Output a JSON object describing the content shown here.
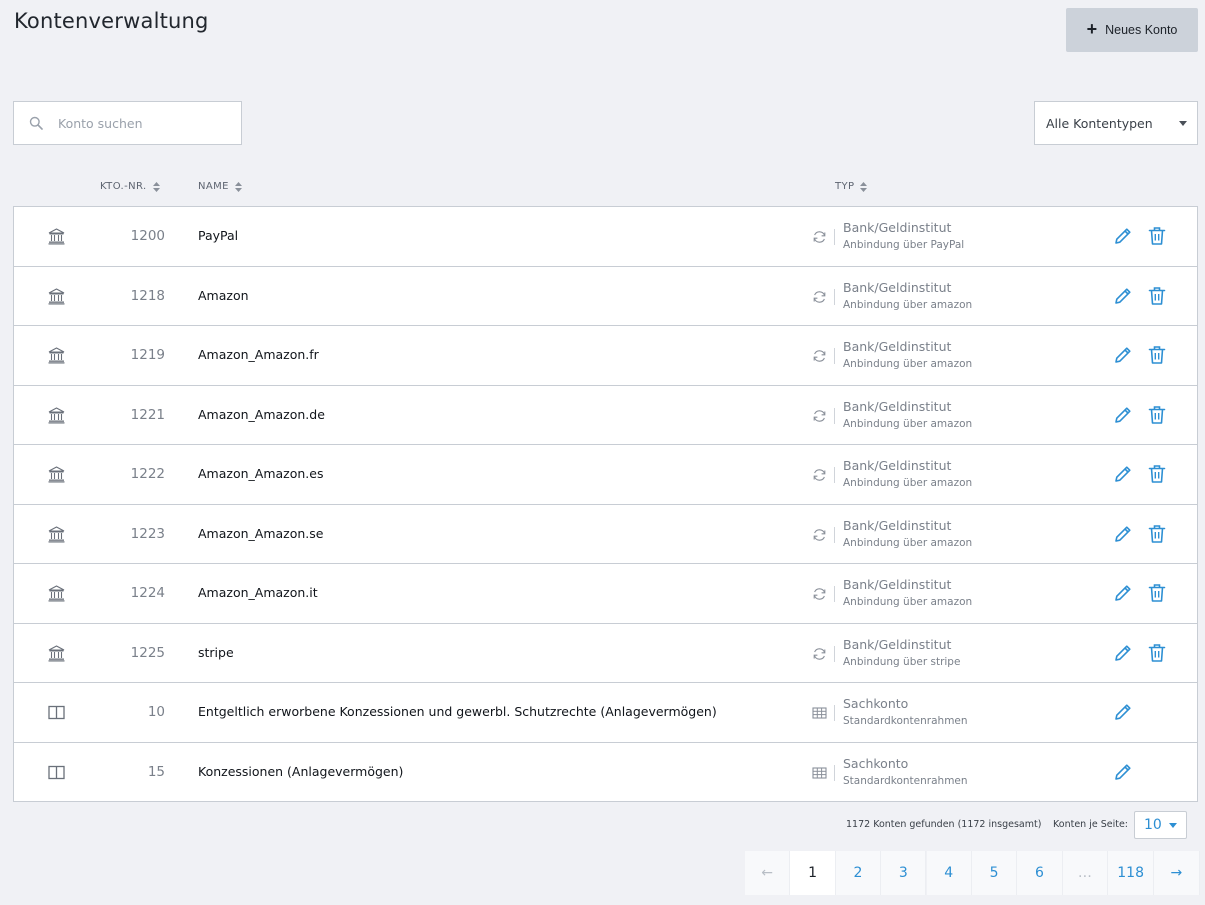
{
  "header": {
    "title": "Kontenverwaltung",
    "new_button_label": "Neues Konto",
    "new_button_icon": "plus-icon"
  },
  "search": {
    "placeholder": "Konto suchen",
    "value": "",
    "icon": "search-icon"
  },
  "filter": {
    "selected": "Alle Kontentypen"
  },
  "columns": {
    "number": "KTO.-NR.",
    "name": "NAME",
    "type": "TYP"
  },
  "rows": [
    {
      "icon": "bank-icon",
      "number": "1200",
      "name": "PayPal",
      "type_icon": "sync-icon",
      "type": "Bank/Geldinstitut",
      "type_sub": "Anbindung über PayPal",
      "deletable": true
    },
    {
      "icon": "bank-icon",
      "number": "1218",
      "name": "Amazon",
      "type_icon": "sync-icon",
      "type": "Bank/Geldinstitut",
      "type_sub": "Anbindung über amazon",
      "deletable": true
    },
    {
      "icon": "bank-icon",
      "number": "1219",
      "name": "Amazon_Amazon.fr",
      "type_icon": "sync-icon",
      "type": "Bank/Geldinstitut",
      "type_sub": "Anbindung über amazon",
      "deletable": true
    },
    {
      "icon": "bank-icon",
      "number": "1221",
      "name": "Amazon_Amazon.de",
      "type_icon": "sync-icon",
      "type": "Bank/Geldinstitut",
      "type_sub": "Anbindung über amazon",
      "deletable": true
    },
    {
      "icon": "bank-icon",
      "number": "1222",
      "name": "Amazon_Amazon.es",
      "type_icon": "sync-icon",
      "type": "Bank/Geldinstitut",
      "type_sub": "Anbindung über amazon",
      "deletable": true
    },
    {
      "icon": "bank-icon",
      "number": "1223",
      "name": "Amazon_Amazon.se",
      "type_icon": "sync-icon",
      "type": "Bank/Geldinstitut",
      "type_sub": "Anbindung über amazon",
      "deletable": true
    },
    {
      "icon": "bank-icon",
      "number": "1224",
      "name": "Amazon_Amazon.it",
      "type_icon": "sync-icon",
      "type": "Bank/Geldinstitut",
      "type_sub": "Anbindung über amazon",
      "deletable": true
    },
    {
      "icon": "bank-icon",
      "number": "1225",
      "name": "stripe",
      "type_icon": "sync-icon",
      "type": "Bank/Geldinstitut",
      "type_sub": "Anbindung über stripe",
      "deletable": true
    },
    {
      "icon": "book-icon",
      "number": "10",
      "name": "Entgeltlich erworbene Konzessionen und gewerbl. Schutzrechte (Anlagevermögen)",
      "type_icon": "table-icon",
      "type": "Sachkonto",
      "type_sub": "Standardkontenrahmen",
      "deletable": false
    },
    {
      "icon": "book-icon",
      "number": "15",
      "name": "Konzessionen (Anlagevermögen)",
      "type_icon": "table-icon",
      "type": "Sachkonto",
      "type_sub": "Standardkontenrahmen",
      "deletable": false
    }
  ],
  "footer": {
    "result_text": "1172 Konten gefunden (1172 insgesamt)",
    "per_page_label": "Konten je Seite:",
    "per_page_value": "10"
  },
  "pagination": {
    "prev": "←",
    "next": "→",
    "pages": [
      "1",
      "2",
      "3",
      "4",
      "5",
      "6",
      "…",
      "118"
    ],
    "current": "1"
  },
  "colors": {
    "accent": "#2d8fd3",
    "background": "#f0f1f5",
    "muted_text": "#7a808a"
  }
}
